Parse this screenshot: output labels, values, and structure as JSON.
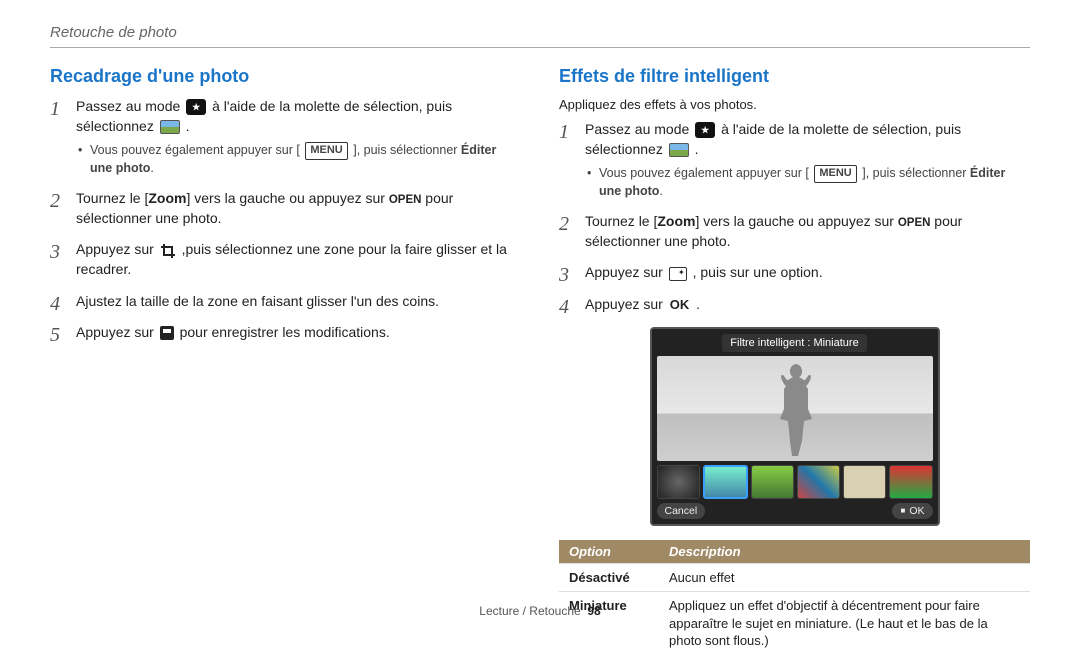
{
  "header": {
    "breadcrumb": "Retouche de photo"
  },
  "labels": {
    "menu": "MENU",
    "ok": "OK",
    "open": "OPEN"
  },
  "left": {
    "title": "Recadrage d'une photo",
    "steps": {
      "s1_a": "Passez au mode ",
      "s1_b": " à l'aide de la molette de sélection, puis sélectionnez ",
      "s1_end": ".",
      "s1_sub_a": "Vous pouvez également appuyer sur [",
      "s1_sub_b": "], puis sélectionner ",
      "s1_sub_bold": "Éditer une photo",
      "s1_sub_end": ".",
      "s2_a": "Tournez le [",
      "s2_zoom": "Zoom",
      "s2_b": "] vers la gauche ou appuyez sur ",
      "s2_c": " pour sélectionner une photo.",
      "s3_a": "Appuyez sur ",
      "s3_b": " ,puis sélectionnez une zone pour la faire glisser et la recadrer.",
      "s4": "Ajustez la taille de la zone en faisant glisser l'un des coins.",
      "s5_a": "Appuyez sur ",
      "s5_b": " pour enregistrer les modifications."
    }
  },
  "right": {
    "title": "Effets de filtre intelligent",
    "intro": "Appliquez des effets à vos photos.",
    "steps": {
      "s1_a": "Passez au mode ",
      "s1_b": " à l'aide de la molette de sélection, puis sélectionnez ",
      "s1_end": ".",
      "s1_sub_a": "Vous pouvez également appuyer sur [",
      "s1_sub_b": "], puis sélectionner ",
      "s1_sub_bold": "Éditer une photo",
      "s1_sub_end": ".",
      "s2_a": "Tournez le [",
      "s2_zoom": "Zoom",
      "s2_b": "] vers la gauche ou appuyez sur ",
      "s2_c": " pour sélectionner une photo.",
      "s3_a": "Appuyez sur ",
      "s3_b": " , puis sur une option.",
      "s4_a": "Appuyez sur ",
      "s4_b": "."
    },
    "screen": {
      "filter_label": "Filtre intelligent : Miniature",
      "cancel": "Cancel",
      "ok": "OK"
    },
    "table": {
      "h_option": "Option",
      "h_desc": "Description",
      "rows": [
        {
          "opt": "Désactivé",
          "desc": "Aucun effet"
        },
        {
          "opt": "Miniature",
          "desc": "Appliquez un effet d'objectif à décentrement pour faire apparaître le sujet en miniature. (Le haut et le bas de la photo sont flous.)"
        }
      ]
    }
  },
  "footer": {
    "section": "Lecture / Retouche",
    "page": "98"
  }
}
